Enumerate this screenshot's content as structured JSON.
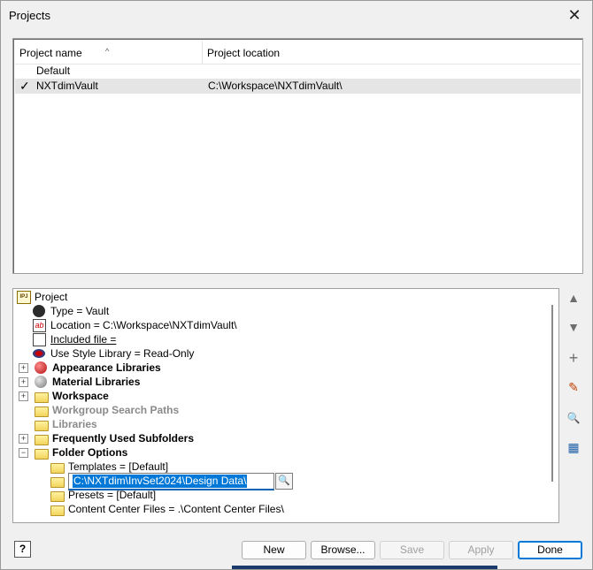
{
  "window": {
    "title": "Projects",
    "close_glyph": "✕"
  },
  "project_list": {
    "columns": [
      "Project name",
      "Project location"
    ],
    "rows": [
      {
        "name": "Default",
        "location": "",
        "active": false
      },
      {
        "name": "NXTdimVault",
        "location": "C:\\Workspace\\NXTdimVault\\",
        "active": true
      }
    ],
    "check_glyph": "✓"
  },
  "tree": {
    "root": "Project",
    "items": [
      {
        "label": "Type = Vault",
        "icon": "type-icon"
      },
      {
        "label": "Location = C:\\Workspace\\NXTdimVault\\",
        "icon": "location-icon"
      },
      {
        "label": "Included file = ",
        "icon": "included-file-icon"
      },
      {
        "label": "Use Style Library = Read-Only",
        "icon": "style-library-icon"
      },
      {
        "label": "Appearance Libraries",
        "icon": "appearance-library-icon"
      },
      {
        "label": "Material Libraries",
        "icon": "material-library-icon"
      },
      {
        "label": "Workspace",
        "icon": "workspace-icon"
      },
      {
        "label": "Workgroup Search Paths",
        "icon": "workgroup-icon"
      },
      {
        "label": "Libraries",
        "icon": "libraries-icon"
      },
      {
        "label": "Frequently Used Subfolders",
        "icon": "subfolders-icon"
      },
      {
        "label": "Folder Options",
        "icon": "folder-options-icon"
      },
      {
        "label": "Templates = [Default]",
        "icon": "folder-icon"
      },
      {
        "label": "C:\\NXTdim\\InvSet2024\\Design Data\\",
        "icon": "folder-icon"
      },
      {
        "label": "Presets = [Default]",
        "icon": "folder-icon"
      },
      {
        "label": "Content Center Files = .\\Content Center Files\\",
        "icon": "folder-icon"
      }
    ],
    "expanders": {
      "collapsed": "+",
      "expanded": "−"
    },
    "root_badge": "IPJ",
    "ab_badge": "ab"
  },
  "side_buttons": {
    "up": "▲",
    "down": "▼",
    "add": "+",
    "edit": "✎",
    "find": "🔍",
    "open": "▦"
  },
  "buttons": {
    "help": "?",
    "new": "New",
    "browse": "Browse...",
    "save": "Save",
    "apply": "Apply",
    "done": "Done"
  },
  "colors": {
    "selection": "#0078d7",
    "accent": "#0078d7"
  }
}
